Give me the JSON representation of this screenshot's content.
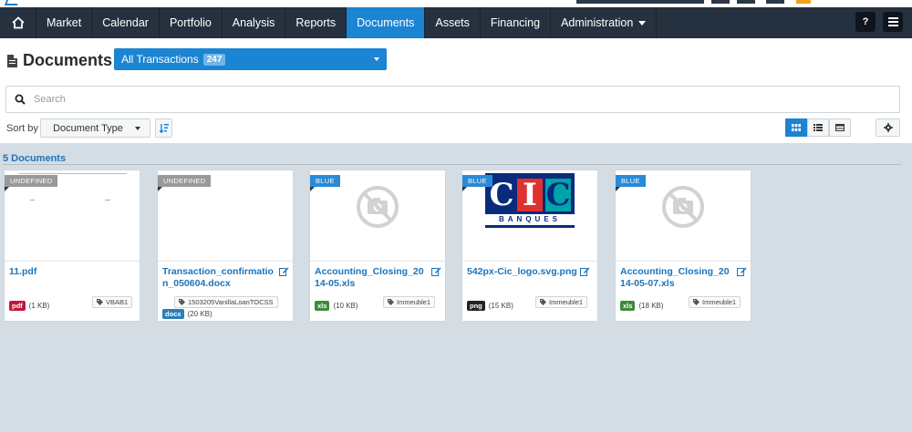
{
  "nav": {
    "items": [
      {
        "label": "Market"
      },
      {
        "label": "Calendar"
      },
      {
        "label": "Portfolio"
      },
      {
        "label": "Analysis"
      },
      {
        "label": "Reports"
      },
      {
        "label": "Documents"
      },
      {
        "label": "Assets"
      },
      {
        "label": "Financing"
      },
      {
        "label": "Administration"
      }
    ],
    "active_label": "Documents",
    "help_label": "?"
  },
  "page": {
    "title": "Documents",
    "filter_label": "All Transactions",
    "filter_count": "247"
  },
  "search": {
    "placeholder": "Search",
    "value": ""
  },
  "sort": {
    "label": "Sort by",
    "field": "Document Type"
  },
  "list": {
    "heading": "5 Documents"
  },
  "documents": [
    {
      "status": "UNDEFINED",
      "name": "11.pdf",
      "ext": "pdf",
      "size": "(1 KB)",
      "tag": "VBAB1"
    },
    {
      "status": "UNDEFINED",
      "name": "Transaction_confirmation_050604.docx",
      "ext": "docx",
      "size": "(20 KB)",
      "tag": "1503205VanillaLoanTOCSS"
    },
    {
      "status": "BLUE",
      "name": "Accounting_Closing_2014-05.xls",
      "ext": "xls",
      "size": "(10 KB)",
      "tag": "Immeuble1"
    },
    {
      "status": "BLUE",
      "name": "542px-Cic_logo.svg.png",
      "ext": "png",
      "size": "(15 KB)",
      "tag": "Immeuble1"
    },
    {
      "status": "BLUE",
      "name": "Accounting_Closing_2014-05-07.xls",
      "ext": "xls",
      "size": "(18 KB)",
      "tag": "Immeuble1"
    }
  ],
  "cic_logo": {
    "letters": [
      "C",
      "I",
      "C"
    ],
    "subtitle": "BANQUES"
  },
  "colors": {
    "accent": "#1b84d3",
    "navbar": "#25313f",
    "pdf": "#c0183c",
    "docx": "#2a7fb6",
    "xls": "#3f8a3a",
    "png": "#222222"
  },
  "icons": {
    "home": "home-icon",
    "search": "search-icon",
    "sort_order": "sort-order-icon",
    "grid": "grid-view-icon",
    "list": "list-view-icon",
    "table": "table-view-icon",
    "settings": "gear-icon",
    "edit": "edit-icon",
    "no_preview": "no-preview-icon",
    "tag": "tag-icon"
  }
}
